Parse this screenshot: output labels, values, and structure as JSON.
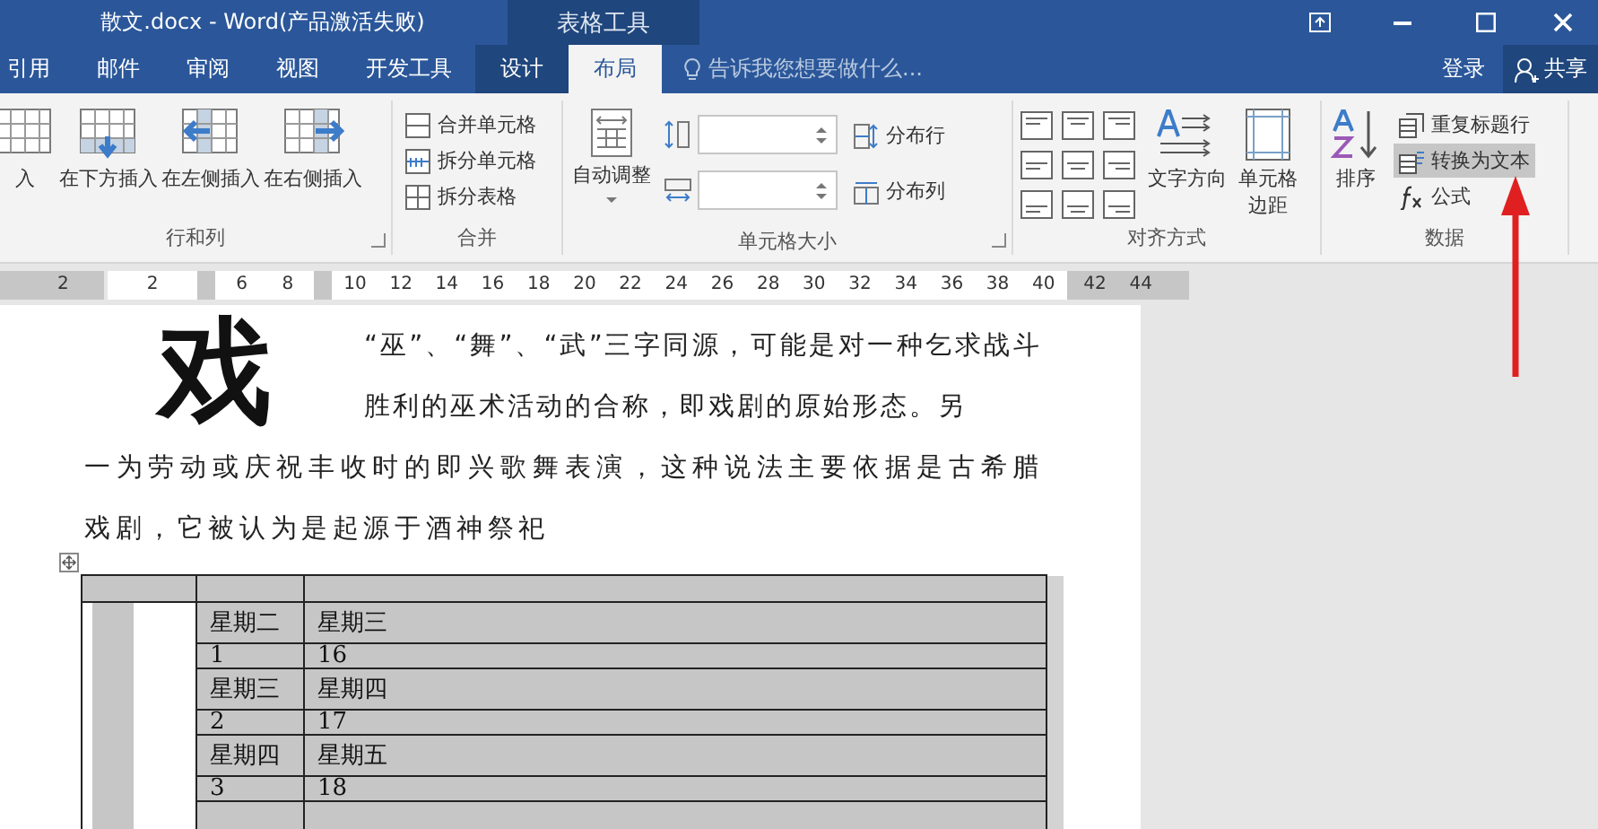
{
  "window": {
    "title": "散文.docx - Word(产品激活失败)",
    "context_group": "表格工具"
  },
  "tabs": [
    {
      "label": "引用",
      "selected": false,
      "contextual": false
    },
    {
      "label": "邮件",
      "selected": false,
      "contextual": false
    },
    {
      "label": "审阅",
      "selected": false,
      "contextual": false
    },
    {
      "label": "视图",
      "selected": false,
      "contextual": false
    },
    {
      "label": "开发工具",
      "selected": false,
      "contextual": false
    },
    {
      "label": "设计",
      "selected": false,
      "contextual": true
    },
    {
      "label": "布局",
      "selected": true,
      "contextual": true
    }
  ],
  "tell_me": {
    "placeholder": "告诉我您想要做什么..."
  },
  "account": {
    "sign_in": "登录",
    "share": "共享"
  },
  "ribbon": {
    "rows_columns": {
      "label": "行和列",
      "buttons": [
        "入",
        "在下方插入",
        "在左侧插入",
        "在右侧插入"
      ]
    },
    "merge": {
      "label": "合并",
      "buttons": [
        "合并单元格",
        "拆分单元格",
        "拆分表格"
      ]
    },
    "cell_size": {
      "label": "单元格大小",
      "autofit": "自动调整",
      "distribute": [
        "分布行",
        "分布列"
      ]
    },
    "alignment": {
      "label": "对齐方式",
      "text_direction": "文字方向",
      "cell_margins": "单元格边距"
    },
    "data": {
      "label": "数据",
      "sort": "排序",
      "buttons": [
        {
          "label": "重复标题行",
          "highlighted": false
        },
        {
          "label": "转换为文本",
          "highlighted": true
        },
        {
          "label": "公式",
          "highlighted": false
        }
      ]
    }
  },
  "ruler": [
    {
      "shaded": true,
      "labels": [
        "2"
      ]
    },
    {
      "shaded": false,
      "labels": [
        "2"
      ]
    },
    {
      "shaded": true
    },
    {
      "shaded": false,
      "labels": [
        "6",
        "8"
      ]
    },
    {
      "shaded": true
    },
    {
      "shaded": false,
      "labels": [
        "10",
        "12",
        "14",
        "16",
        "18",
        "20",
        "22",
        "24",
        "26",
        "28",
        "30",
        "32",
        "34",
        "36",
        "38",
        "40"
      ]
    },
    {
      "shaded": true,
      "labels": [
        "42",
        "44"
      ]
    }
  ],
  "document": {
    "drop_cap": "戏",
    "paragraph_lead": "“巫”、“舞”、“武”三字同源，可能是对一种乞求战斗胜利的巫术活动的合称，即戏剧的原始形态。另",
    "paragraph_rest": "一为劳动或庆祝丰收时的即兴歌舞表演，这种说法主要依据是古希腊戏剧，它被认为是起源于酒神祭祀",
    "table": {
      "selected": true,
      "rows": [
        {
          "kind": "label",
          "cells": [
            "星期二",
            "星期三"
          ]
        },
        {
          "kind": "number",
          "cells": [
            "1",
            "16"
          ]
        },
        {
          "kind": "label",
          "cells": [
            "星期三",
            "星期四"
          ]
        },
        {
          "kind": "number",
          "cells": [
            "2",
            "17"
          ]
        },
        {
          "kind": "label",
          "cells": [
            "星期四",
            "星期五"
          ]
        },
        {
          "kind": "number",
          "cells": [
            "3",
            "18"
          ]
        }
      ]
    }
  }
}
